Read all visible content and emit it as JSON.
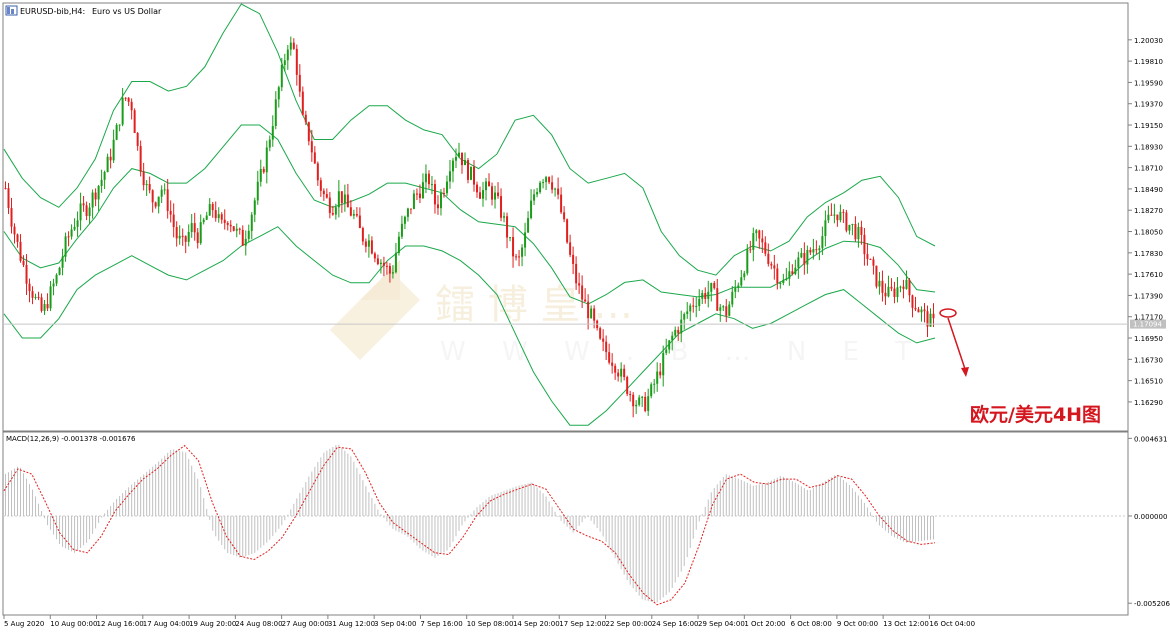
{
  "header": {
    "symbol": "EURUSD-bib,H4:",
    "description": "Euro vs US Dollar"
  },
  "watermark": {
    "cn": "鐳 博 皇 …",
    "latin": "W W W . B … N E T"
  },
  "annotation": {
    "label": "欧元/美元4H图",
    "arrow_color": "#d4161f"
  },
  "colors": {
    "bull": "#1a9c1a",
    "bear": "#e0201f",
    "bands": "#1aa84a",
    "macd_hist": "#c0c0c0",
    "macd_signal": "#e0201f",
    "current_line": "#c0c0c0",
    "watermark": "#f2e2c4"
  },
  "chart_data": [
    {
      "type": "candlestick",
      "title": "EURUSD-bib,H4:  Euro vs US Dollar",
      "indicator": "Bollinger Bands",
      "ylim": [
        1.16,
        1.204
      ],
      "y_ticks": [
        "1.20030",
        "1.19810",
        "1.19590",
        "1.19370",
        "1.19150",
        "1.18930",
        "1.18710",
        "1.18490",
        "1.18270",
        "1.18050",
        "1.17830",
        "1.17610",
        "1.17390",
        "1.17170",
        "1.16950",
        "1.16730",
        "1.16510",
        "1.16290"
      ],
      "y_tick_values": [
        1.2003,
        1.1981,
        1.1959,
        1.1937,
        1.1915,
        1.1893,
        1.1871,
        1.1849,
        1.1827,
        1.1805,
        1.1783,
        1.1761,
        1.1739,
        1.1717,
        1.1695,
        1.1673,
        1.1651,
        1.1629
      ],
      "current_price": "1.17094",
      "x_ticks": [
        "5 Aug 2020",
        "10 Aug 00:00",
        "12 Aug 16:00",
        "17 Aug 04:00",
        "19 Aug 20:00",
        "24 Aug 08:00",
        "27 Aug 00:00",
        "31 Aug 12:00",
        "3 Sep 04:00",
        "7 Sep 16:00",
        "10 Sep 08:00",
        "14 Sep 20:00",
        "17 Sep 12:00",
        "22 Sep 00:00",
        "24 Sep 16:00",
        "29 Sep 04:00",
        "1 Oct 20:00",
        "6 Oct 08:00",
        "9 Oct 00:00",
        "13 Oct 12:00",
        "16 Oct 04:00"
      ],
      "close_path": [
        1.185,
        1.181,
        1.178,
        1.1755,
        1.1735,
        1.172,
        1.174,
        1.176,
        1.179,
        1.181,
        1.1825,
        1.183,
        1.1845,
        1.186,
        1.188,
        1.191,
        1.1945,
        1.1935,
        1.188,
        1.185,
        1.1835,
        1.185,
        1.183,
        1.18,
        1.179,
        1.181,
        1.18,
        1.182,
        1.183,
        1.181,
        1.182,
        1.1805,
        1.1795,
        1.182,
        1.185,
        1.188,
        1.192,
        1.196,
        1.2,
        1.199,
        1.192,
        1.19,
        1.186,
        1.184,
        1.183,
        1.1845,
        1.183,
        1.182,
        1.18,
        1.1795,
        1.178,
        1.177,
        1.176,
        1.18,
        1.182,
        1.184,
        1.185,
        1.186,
        1.183,
        1.185,
        1.188,
        1.189,
        1.187,
        1.186,
        1.1845,
        1.185,
        1.184,
        1.182,
        1.179,
        1.177,
        1.18,
        1.184,
        1.186,
        1.1865,
        1.185,
        1.182,
        1.178,
        1.175,
        1.173,
        1.1715,
        1.169,
        1.168,
        1.167,
        1.1655,
        1.164,
        1.1628,
        1.1625,
        1.164,
        1.166,
        1.168,
        1.17,
        1.171,
        1.1725,
        1.1735,
        1.174,
        1.1745,
        1.173,
        1.172,
        1.174,
        1.176,
        1.178,
        1.18,
        1.179,
        1.1775,
        1.176,
        1.175,
        1.177,
        1.1775,
        1.178,
        1.179,
        1.18,
        1.182,
        1.1825,
        1.1815,
        1.181,
        1.18,
        1.178,
        1.176,
        1.1745,
        1.174,
        1.1745,
        1.1755,
        1.1735,
        1.1725,
        1.1715,
        1.1709
      ],
      "bb_upper": [
        1.189,
        1.186,
        1.184,
        1.183,
        1.185,
        1.188,
        1.193,
        1.196,
        1.196,
        1.195,
        1.1955,
        1.1975,
        1.201,
        1.204,
        1.203,
        1.199,
        1.194,
        1.19,
        1.19,
        1.192,
        1.1935,
        1.1935,
        1.192,
        1.191,
        1.1905,
        1.188,
        1.187,
        1.1885,
        1.192,
        1.1925,
        1.1905,
        1.187,
        1.1855,
        1.186,
        1.1865,
        1.185,
        1.1805,
        1.178,
        1.1765,
        1.176,
        1.178,
        1.179,
        1.1785,
        1.1795,
        1.182,
        1.1835,
        1.1845,
        1.1858,
        1.1862,
        1.184,
        1.18,
        1.179
      ],
      "bb_lower": [
        1.172,
        1.1695,
        1.1695,
        1.1715,
        1.1745,
        1.176,
        1.177,
        1.178,
        1.177,
        1.176,
        1.1755,
        1.1765,
        1.1775,
        1.179,
        1.18,
        1.181,
        1.179,
        1.1775,
        1.176,
        1.1752,
        1.1752,
        1.1775,
        1.179,
        1.179,
        1.1785,
        1.1775,
        1.176,
        1.174,
        1.17,
        1.166,
        1.163,
        1.1605,
        1.1605,
        1.162,
        1.164,
        1.166,
        1.168,
        1.17,
        1.171,
        1.172,
        1.1715,
        1.1705,
        1.171,
        1.172,
        1.173,
        1.174,
        1.1745,
        1.173,
        1.1715,
        1.17,
        1.169,
        1.1695
      ]
    },
    {
      "type": "bar",
      "title": "MACD(12,26,9) -0.001378 -0.001676",
      "ylim": [
        -0.00585,
        0.00495
      ],
      "y_ticks": [
        "0.004631",
        "0.000000",
        "-0.005206"
      ],
      "y_tick_values": [
        0.004631,
        0.0,
        -0.005206
      ],
      "macd_main": [
        0.0025,
        0.003,
        0.0015,
        -0.0005,
        -0.0018,
        -0.0022,
        -0.0015,
        0.0,
        0.001,
        0.0018,
        0.0025,
        0.0032,
        0.004,
        0.0038,
        0.002,
        -0.001,
        -0.0022,
        -0.0025,
        -0.0022,
        -0.0015,
        -0.0005,
        0.001,
        0.0025,
        0.0038,
        0.0043,
        0.0035,
        0.0018,
        0.0002,
        -0.0008,
        -0.0012,
        -0.002,
        -0.0025,
        -0.002,
        -0.0005,
        0.0005,
        0.0012,
        0.0015,
        0.0018,
        0.002,
        0.0012,
        -0.0002,
        -0.001,
        0.0,
        -0.001,
        -0.0025,
        -0.004,
        -0.005,
        -0.0052,
        -0.0045,
        -0.003,
        -0.0005,
        0.0015,
        0.0025,
        0.0022,
        0.0018,
        0.002,
        0.0024,
        0.002,
        0.0015,
        0.002,
        0.0025,
        0.0018,
        0.0008,
        -0.0005,
        -0.0012,
        -0.0016,
        -0.0015,
        -0.0014
      ],
      "macd_signal": [
        0.0015,
        0.0028,
        0.0025,
        0.0008,
        -0.001,
        -0.002,
        -0.0022,
        -0.0012,
        0.0003,
        0.0013,
        0.0022,
        0.0028,
        0.0036,
        0.0042,
        0.0033,
        0.0008,
        -0.0012,
        -0.0024,
        -0.0026,
        -0.0021,
        -0.0013,
        0.0,
        0.0015,
        0.003,
        0.0041,
        0.004,
        0.0026,
        0.0008,
        -0.0004,
        -0.001,
        -0.0016,
        -0.0022,
        -0.0023,
        -0.0013,
        0.0,
        0.0009,
        0.0013,
        0.0016,
        0.0019,
        0.0016,
        0.0004,
        -0.0008,
        -0.0012,
        -0.0015,
        -0.0022,
        -0.0035,
        -0.0046,
        -0.0053,
        -0.005,
        -0.004,
        -0.0018,
        0.0007,
        0.0022,
        0.0025,
        0.002,
        0.0019,
        0.0022,
        0.0022,
        0.0017,
        0.0019,
        0.0024,
        0.0022,
        0.0012,
        0.0,
        -0.0009,
        -0.0015,
        -0.0017,
        -0.0016
      ]
    }
  ]
}
